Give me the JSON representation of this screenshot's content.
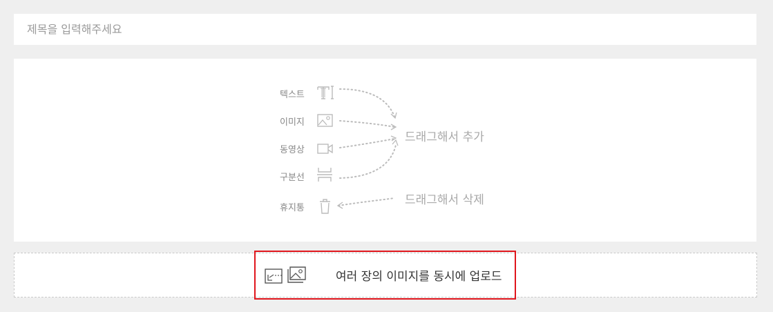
{
  "title_field": {
    "placeholder": "제목을 입력해주세요",
    "value": ""
  },
  "editor": {
    "tools": [
      {
        "label": "텍스트",
        "icon": "text-icon"
      },
      {
        "label": "이미지",
        "icon": "image-icon"
      },
      {
        "label": "동영상",
        "icon": "video-icon"
      },
      {
        "label": "구분선",
        "icon": "divider-icon"
      },
      {
        "label": "휴지통",
        "icon": "trash-icon"
      }
    ],
    "hint_add": "드래그해서 추가",
    "hint_delete": "드래그해서 삭제"
  },
  "upload": {
    "label": "여러 장의 이미지를 동시에 업로드",
    "icon": "multi-image-upload-icon",
    "highlight_color": "#e0141b"
  }
}
